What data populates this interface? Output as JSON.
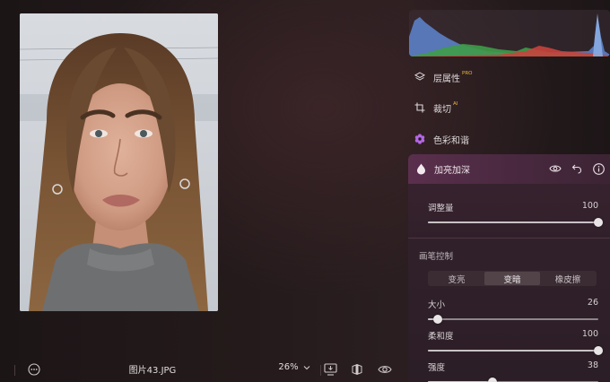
{
  "canvas": {
    "filename": "图片43.JPG",
    "zoom": "26%"
  },
  "panel": {
    "tools": [
      {
        "label": "层属性",
        "badge": "PRO"
      },
      {
        "label": "裁切",
        "badge": "AI"
      },
      {
        "label": "色彩和谐",
        "badge": ""
      }
    ],
    "dodge": {
      "title": "加亮加深",
      "amount": {
        "label": "调整量",
        "value": "100",
        "fraction": 1.0
      },
      "brush_label": "画笔控制",
      "modes": [
        "变亮",
        "变暗",
        "橡皮擦"
      ],
      "active_mode": 1,
      "size": {
        "label": "大小",
        "value": "26",
        "fraction": 0.06
      },
      "softness": {
        "label": "柔和度",
        "value": "100",
        "fraction": 1.0
      },
      "strength": {
        "label": "强度",
        "value": "38",
        "fraction": 0.38
      }
    }
  },
  "colors": {
    "accent": "#5a2f4d",
    "color_icon": "#b467e6",
    "badge": "#e5b93f"
  }
}
